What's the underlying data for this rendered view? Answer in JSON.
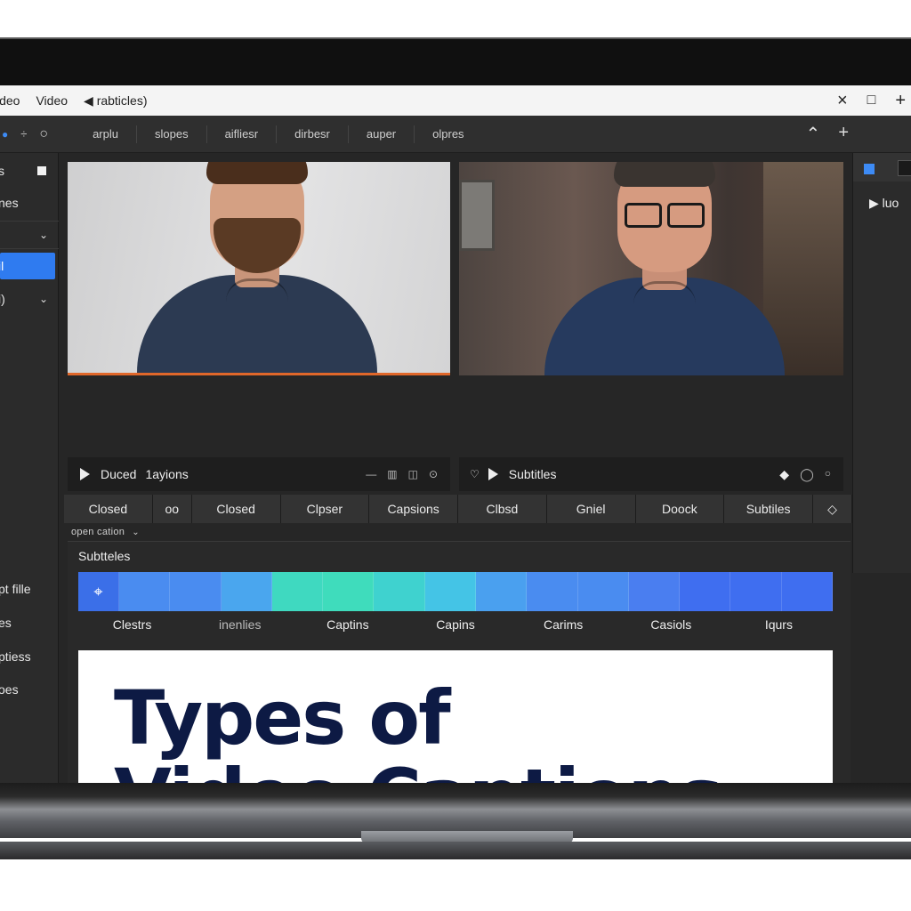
{
  "window": {
    "title_items": [
      "ideo",
      "Video",
      "rabticles)"
    ],
    "controls": [
      "×",
      "□",
      "+"
    ]
  },
  "toolbar": {
    "items": [
      "arplu",
      "slopes",
      "aifliesr",
      "dirbesr",
      "auper",
      "olpres"
    ],
    "right_icons": [
      "⌃",
      "+"
    ]
  },
  "sidebar": {
    "items": [
      {
        "label": "s"
      },
      {
        "label": "nes"
      },
      {
        "label": ""
      },
      {
        "label": "il"
      },
      {
        "label": "i)"
      },
      {
        "label": "pt fille"
      },
      {
        "label": "es"
      },
      {
        "label": "ptiess"
      },
      {
        "label": "oes"
      }
    ]
  },
  "right_panel": {
    "label": "▶ luo"
  },
  "video_left": {
    "label": "Duced",
    "secondary": "1ayions"
  },
  "video_right": {
    "label": "Subtitles"
  },
  "caption_tabs": [
    "Closed",
    "oo",
    "Closed",
    "Clpser",
    "Capsions",
    "Clbsd",
    "Gniel",
    "Doock",
    "Subtiles",
    "◇"
  ],
  "subtitle_select": "open cation",
  "subtitles_label": "Subtteles",
  "timeline": {
    "labels": [
      "Clestrs",
      "inenlies",
      "Captins",
      "Capins",
      "Carims",
      "Casiols",
      "Iqurs"
    ],
    "segment_colors": [
      "#4a8cf0",
      "#4a8cf0",
      "#4aa6ee",
      "#3fd9c0",
      "#3fdcbc",
      "#3fd2cf",
      "#44c4e6",
      "#4aa0ef",
      "#4a8cf0",
      "#4a8cf0",
      "#4a7ef0",
      "#3f6ef0",
      "#3f6ef0",
      "#3f6ef0"
    ]
  },
  "title_card": {
    "line1": "Types of",
    "line2": "Video Captions"
  },
  "colors": {
    "accent": "#2f7bf0",
    "title_text": "#0d1a44",
    "progress": "#e0672a"
  }
}
